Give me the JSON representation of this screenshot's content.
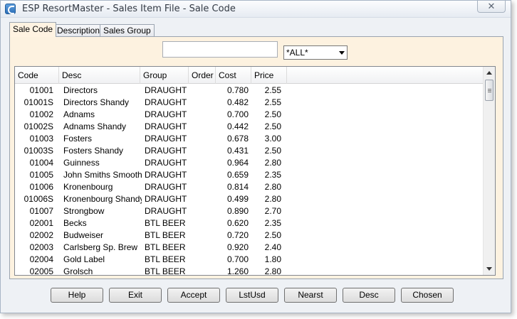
{
  "window": {
    "title": "ESP ResortMaster - Sales Item File - Sale Code",
    "close_label": "✕"
  },
  "tabs": [
    "Sale Code",
    "Description",
    "Sales Group"
  ],
  "filter": {
    "search_value": "",
    "group_selected": "*ALL*"
  },
  "columns": [
    "Code",
    "Desc",
    "Group",
    "Order",
    "Cost",
    "Price"
  ],
  "rows": [
    {
      "code": "01001",
      "desc": "Directors",
      "group": "DRAUGHT",
      "order": "",
      "cost": "0.780",
      "price": "2.55"
    },
    {
      "code": "01001S",
      "desc": "Directors Shandy",
      "group": "DRAUGHT",
      "order": "",
      "cost": "0.482",
      "price": "2.55"
    },
    {
      "code": "01002",
      "desc": "Adnams",
      "group": "DRAUGHT",
      "order": "",
      "cost": "0.700",
      "price": "2.50"
    },
    {
      "code": "01002S",
      "desc": "Adnams Shandy",
      "group": "DRAUGHT",
      "order": "",
      "cost": "0.442",
      "price": "2.50"
    },
    {
      "code": "01003",
      "desc": "Fosters",
      "group": "DRAUGHT",
      "order": "",
      "cost": "0.678",
      "price": "3.00"
    },
    {
      "code": "01003S",
      "desc": "Fosters Shandy",
      "group": "DRAUGHT",
      "order": "",
      "cost": "0.431",
      "price": "2.50"
    },
    {
      "code": "01004",
      "desc": "Guinness",
      "group": "DRAUGHT",
      "order": "",
      "cost": "0.964",
      "price": "2.80"
    },
    {
      "code": "01005",
      "desc": "John Smiths Smooth",
      "group": "DRAUGHT",
      "order": "",
      "cost": "0.659",
      "price": "2.35"
    },
    {
      "code": "01006",
      "desc": "Kronenbourg",
      "group": "DRAUGHT",
      "order": "",
      "cost": "0.814",
      "price": "2.80"
    },
    {
      "code": "01006S",
      "desc": "Kronenbourg Shandy",
      "group": "DRAUGHT",
      "order": "",
      "cost": "0.499",
      "price": "2.80"
    },
    {
      "code": "01007",
      "desc": "Strongbow",
      "group": "DRAUGHT",
      "order": "",
      "cost": "0.890",
      "price": "2.70"
    },
    {
      "code": "02001",
      "desc": "Becks",
      "group": "BTL BEER",
      "order": "",
      "cost": "0.620",
      "price": "2.35"
    },
    {
      "code": "02002",
      "desc": "Budweiser",
      "group": "BTL BEER",
      "order": "",
      "cost": "0.720",
      "price": "2.50"
    },
    {
      "code": "02003",
      "desc": "Carlsberg Sp. Brew",
      "group": "BTL BEER",
      "order": "",
      "cost": "0.920",
      "price": "2.40"
    },
    {
      "code": "02004",
      "desc": "Gold Label",
      "group": "BTL BEER",
      "order": "",
      "cost": "0.700",
      "price": "1.80"
    },
    {
      "code": "02005",
      "desc": "Grolsch",
      "group": "BTL BEER",
      "order": "",
      "cost": "1.260",
      "price": "2.80"
    }
  ],
  "buttons": [
    "Help",
    "Exit",
    "Accept",
    "LstUsd",
    "Nearst",
    "Desc",
    "Chosen"
  ]
}
